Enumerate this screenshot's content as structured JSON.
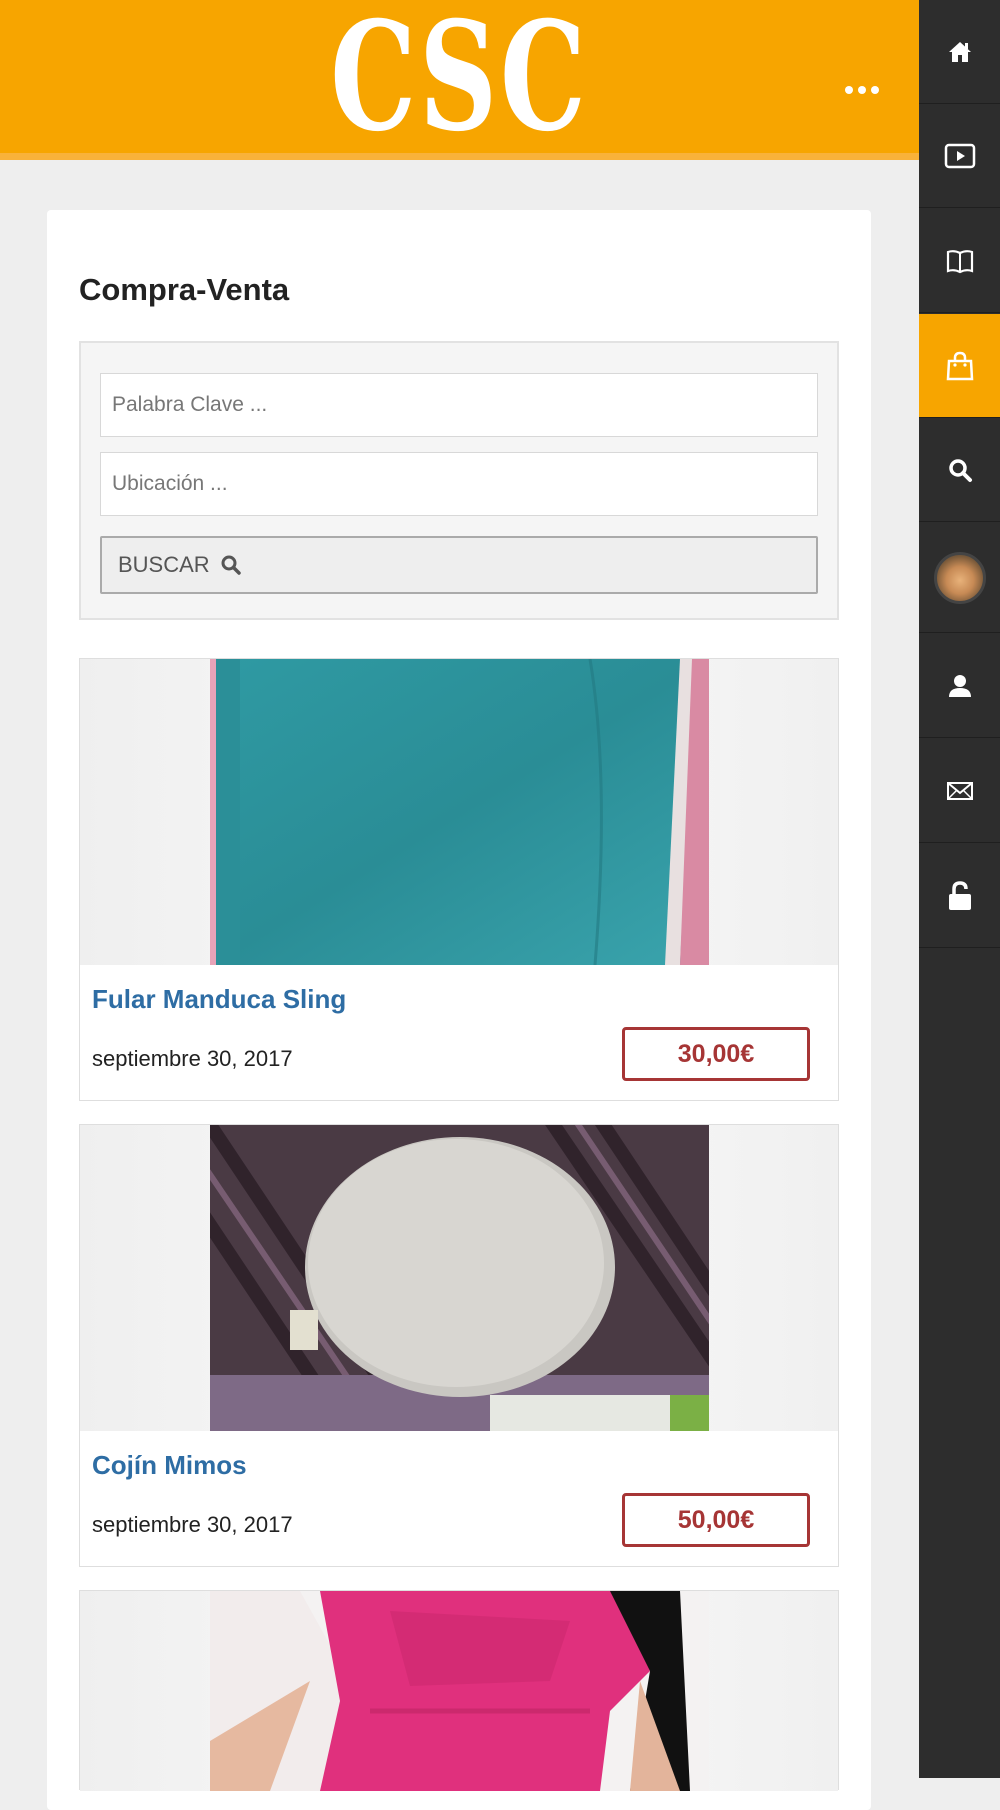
{
  "header": {
    "logo_text": "CSC",
    "brand_color": "#f7a500"
  },
  "page": {
    "title": "Compra-Venta"
  },
  "search": {
    "keyword_placeholder": "Palabra Clave ...",
    "location_placeholder": "Ubicación ...",
    "button_label": "BUSCAR"
  },
  "listings": [
    {
      "title": "Fular Manduca Sling",
      "date": "septiembre 30, 2017",
      "price": "30,00€"
    },
    {
      "title": "Cojín Mimos",
      "date": "septiembre 30, 2017",
      "price": "50,00€"
    }
  ],
  "sidebar": {
    "items": [
      {
        "icon": "home-icon"
      },
      {
        "icon": "play-icon"
      },
      {
        "icon": "book-icon"
      },
      {
        "icon": "shopping-bag-icon",
        "active": true
      },
      {
        "icon": "search-icon"
      },
      {
        "icon": "avatar"
      },
      {
        "icon": "user-icon"
      },
      {
        "icon": "envelope-icon"
      },
      {
        "icon": "unlock-icon"
      }
    ],
    "active_color": "#f7a500"
  },
  "colors": {
    "link": "#2e6da4",
    "price": "#a63535"
  }
}
